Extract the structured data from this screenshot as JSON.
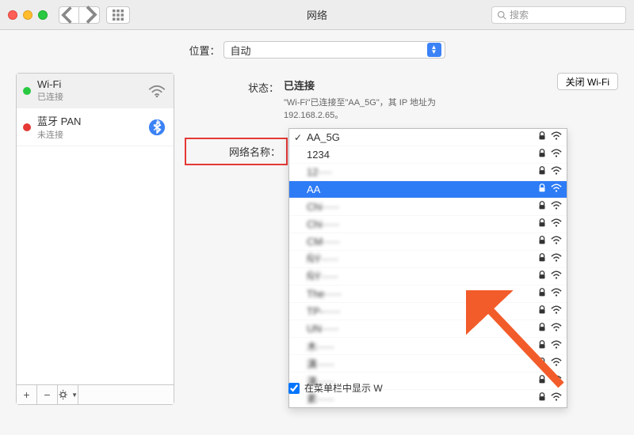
{
  "window": {
    "title": "网络",
    "search_placeholder": "搜索"
  },
  "location": {
    "label": "位置：",
    "value": "自动"
  },
  "sidebar": {
    "services": [
      {
        "name": "Wi-Fi",
        "status": "已连接",
        "color": "#28c940",
        "icon": "wifi"
      },
      {
        "name": "蓝牙 PAN",
        "status": "未连接",
        "color": "#e53935",
        "icon": "bluetooth"
      }
    ]
  },
  "main": {
    "status_label": "状态：",
    "status_value": "已连接",
    "turn_off_label": "关闭 Wi-Fi",
    "status_desc": "\"Wi-Fi\"已连接至\"AA_5G\"，其 IP 地址为 192.168.2.65。",
    "network_name_label": "网络名称：",
    "show_in_menubar_label": "在菜单栏中显示 W",
    "show_in_menubar_checked": true
  },
  "dropdown": {
    "current": "AA_5G",
    "items": [
      {
        "name": "AA_5G",
        "locked": true,
        "checked": true,
        "selected": false
      },
      {
        "name": "1234",
        "locked": true
      },
      {
        "name": "12····",
        "locked": true,
        "blurred": true
      },
      {
        "name": "AA",
        "locked": true,
        "selected": true
      },
      {
        "name": "Chi·····",
        "locked": true,
        "blurred": true
      },
      {
        "name": "Chi·····",
        "locked": true,
        "blurred": true
      },
      {
        "name": "CM·····",
        "locked": true,
        "blurred": true
      },
      {
        "name": "ÑÝ·····",
        "locked": true,
        "blurred": true
      },
      {
        "name": "ÑÝ·····",
        "locked": true,
        "blurred": true
      },
      {
        "name": "The·····",
        "locked": true,
        "blurred": true
      },
      {
        "name": "TP-·····",
        "locked": true,
        "blurred": true
      },
      {
        "name": "UN·····",
        "locked": true,
        "blurred": true
      },
      {
        "name": "木·····",
        "locked": true,
        "blurred": true
      },
      {
        "name": "演·····",
        "locked": true,
        "blurred": true
      },
      {
        "name": "演·····",
        "locked": true,
        "blurred": true
      },
      {
        "name": "素·····",
        "locked": true,
        "blurred": true
      }
    ]
  }
}
